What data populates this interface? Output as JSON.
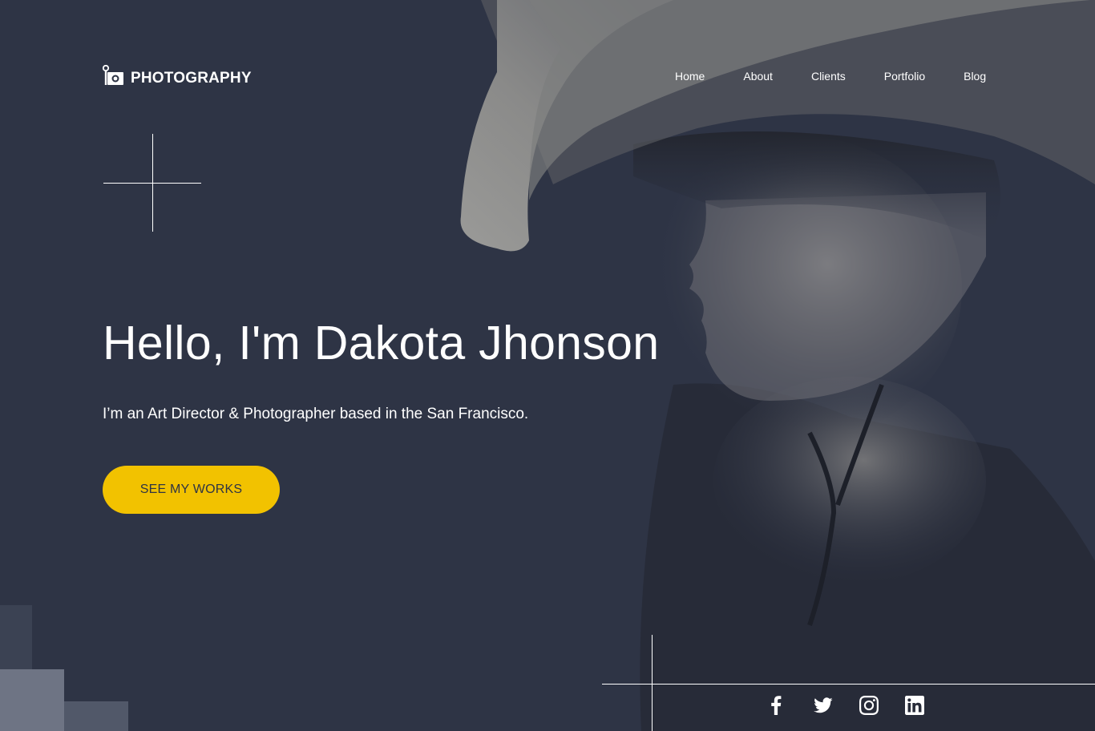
{
  "brand": {
    "name": "PHOTOGRAPHY",
    "logo_icon": "camera-icon"
  },
  "nav": [
    {
      "label": "Home"
    },
    {
      "label": "About"
    },
    {
      "label": "Clients"
    },
    {
      "label": "Portfolio"
    },
    {
      "label": "Blog"
    }
  ],
  "hero": {
    "title": "Hello, I'm Dakota Jhonson",
    "subtitle": "I’m an Art Director & Photographer based in the San Francisco.",
    "cta_label": "SEE MY WORKS",
    "photo_description_icon": "portrait-photo"
  },
  "social": [
    {
      "icon": "facebook-icon"
    },
    {
      "icon": "twitter-icon"
    },
    {
      "icon": "instagram-icon"
    },
    {
      "icon": "linkedin-icon"
    }
  ],
  "colors": {
    "background": "#2e3445",
    "accent": "#f2c200",
    "text": "#ffffff",
    "block_light": "#6e7484",
    "block_mid": "#515869",
    "block_dark": "#3b4253"
  }
}
